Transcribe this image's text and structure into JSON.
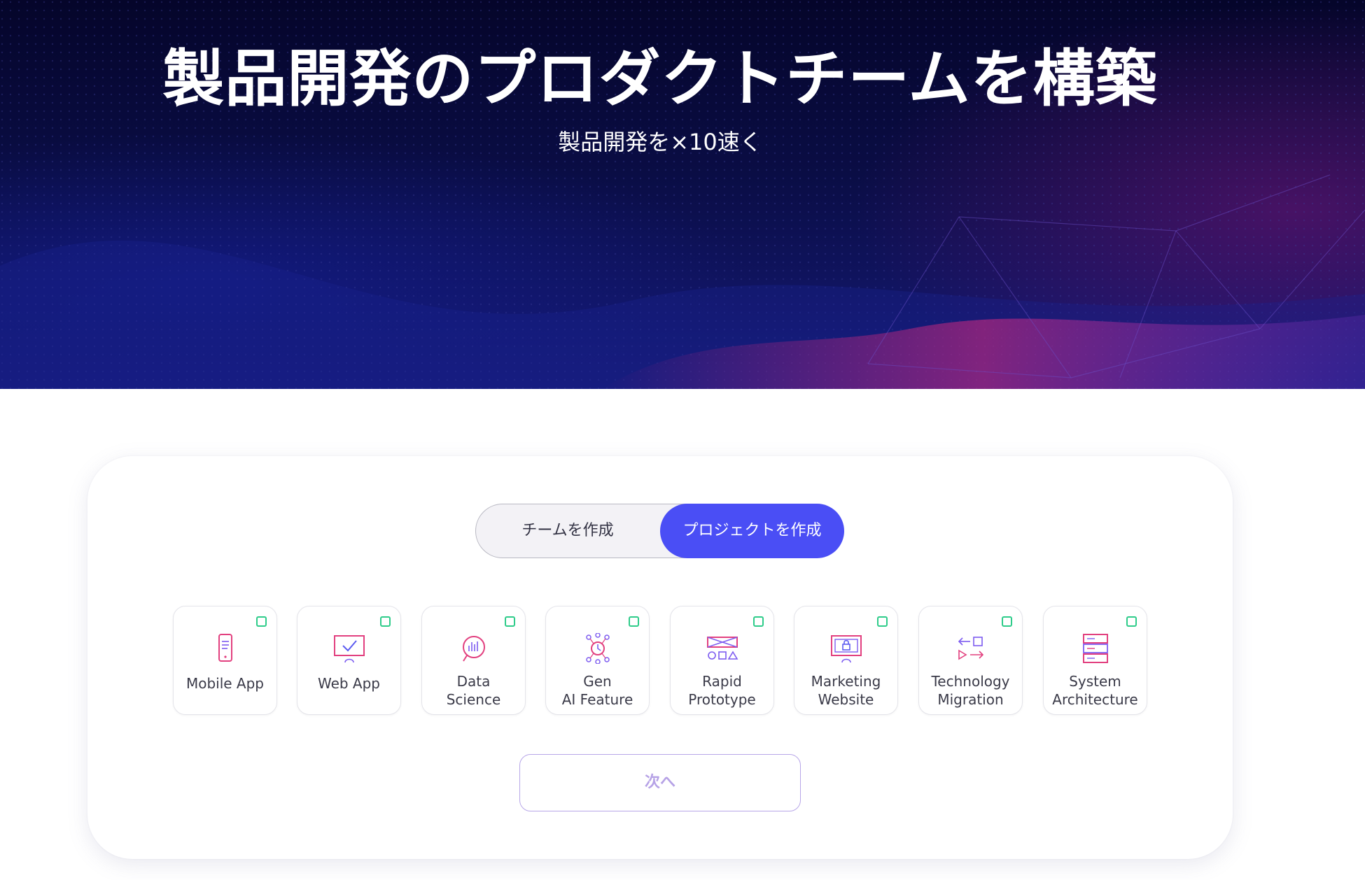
{
  "hero": {
    "title": "製品開発のプロダクトチームを構築",
    "subtitle": "製品開発を×10速く"
  },
  "toggle": {
    "left_label": "チームを作成",
    "right_label": "プロジェクトを作成",
    "selected": "right"
  },
  "project_types": [
    {
      "label": "Mobile App",
      "icon": "mobile-phone-icon",
      "checked": false
    },
    {
      "label": "Web App",
      "icon": "monitor-check-icon",
      "checked": false
    },
    {
      "label": "Data Science",
      "icon": "magnifier-chart-icon",
      "checked": false
    },
    {
      "label": "Gen AI Feature",
      "icon": "network-clock-icon",
      "checked": false
    },
    {
      "label": "Rapid Prototype",
      "icon": "shapes-icon",
      "checked": false
    },
    {
      "label": "Marketing Website",
      "icon": "monitor-lock-icon",
      "checked": false
    },
    {
      "label": "Technology Migration",
      "icon": "arrows-migration-icon",
      "checked": false
    },
    {
      "label": "System Architecture",
      "icon": "server-stack-icon",
      "checked": false
    }
  ],
  "next_button": {
    "label": "次へ"
  },
  "colors": {
    "accent": "#4a4ef5",
    "checkbox": "#2ecc8a",
    "next_text": "#b6a2e6"
  }
}
